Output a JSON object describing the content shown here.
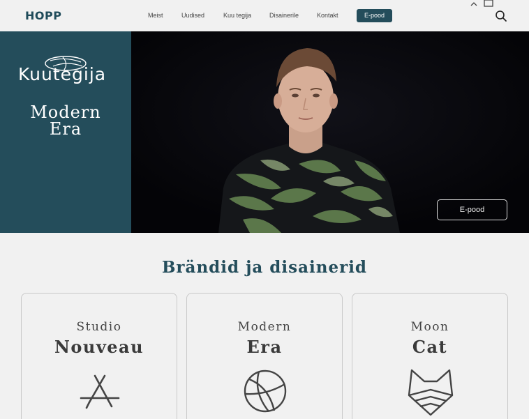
{
  "header": {
    "logo": "HOPP",
    "nav": [
      "Meist",
      "Uudised",
      "Kuu tegija",
      "Disainerile",
      "Kontakt"
    ],
    "shop_button": "E-pood",
    "icons": [
      "bag-icon",
      "search-icon"
    ]
  },
  "hero": {
    "brand": "Kuutegija",
    "title_line1": "Modern",
    "title_line2": "Era",
    "shop_button": "E-pood"
  },
  "section": {
    "title": "Brändid ja disainerid",
    "cards": [
      {
        "top": "Studio",
        "main": "Nouveau",
        "icon": "app-store-icon"
      },
      {
        "top": "Modern",
        "main": "Era",
        "icon": "basketball-icon"
      },
      {
        "top": "Moon",
        "main": "Cat",
        "icon": "fox-icon"
      }
    ]
  },
  "colors": {
    "accent": "#244d5b",
    "background": "#f1f1f1",
    "hero_dark": "#06060a"
  }
}
